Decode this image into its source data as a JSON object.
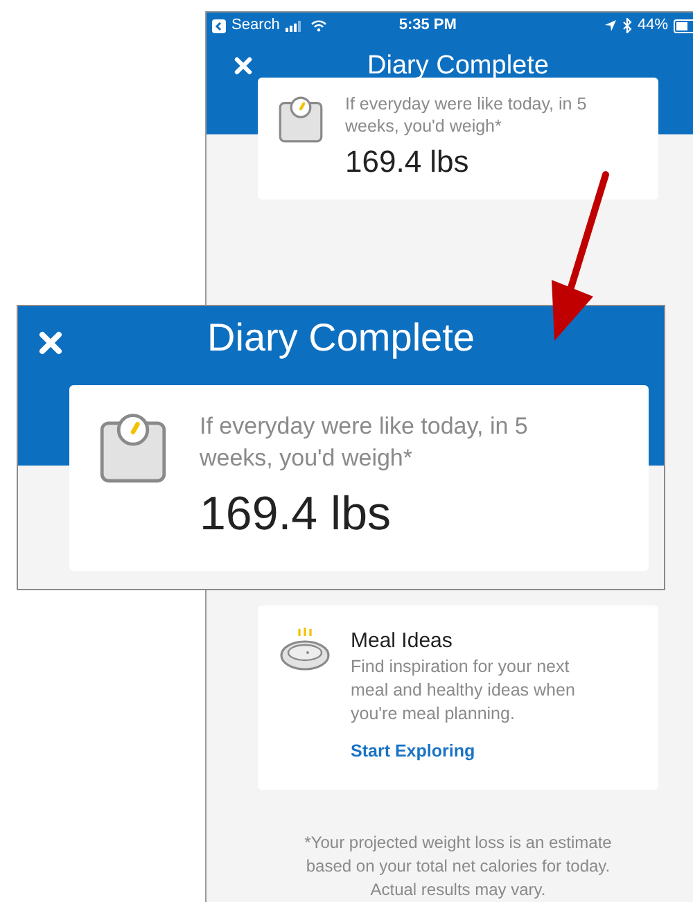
{
  "phone": {
    "status_bar": {
      "back_label": "Search",
      "time": "5:35 PM",
      "battery": "44%"
    },
    "header": {
      "title": "Diary Complete"
    },
    "projection_card": {
      "caption": "If everyday were like today, in 5 weeks, you'd weigh*",
      "weight": "169.4 lbs"
    },
    "meal_card": {
      "title": "Meal Ideas",
      "description": "Find inspiration for your next meal and healthy ideas when you're meal planning.",
      "link": "Start Exploring"
    },
    "footnote": "*Your projected weight loss is an estimate based on your total net calories for today. Actual results may vary."
  },
  "zoomed_inset": {
    "title": "Diary Complete",
    "caption": "If everyday were like today, in 5 weeks, you'd weigh*",
    "weight": "169.4 lbs"
  }
}
